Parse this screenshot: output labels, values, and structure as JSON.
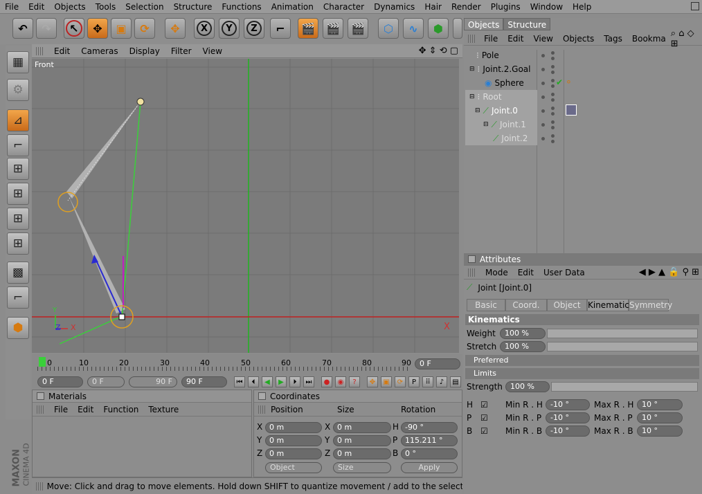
{
  "menu": [
    "File",
    "Edit",
    "Objects",
    "Tools",
    "Selection",
    "Structure",
    "Functions",
    "Animation",
    "Character",
    "Dynamics",
    "Hair",
    "Render",
    "Plugins",
    "Window",
    "Help"
  ],
  "viewport": {
    "menu": [
      "Edit",
      "Cameras",
      "Display",
      "Filter",
      "View"
    ],
    "label": "Front",
    "axis_x": "X",
    "axis_z": "Z",
    "axis_y": "Y",
    "corner_x": "X"
  },
  "timeline": {
    "ticks": [
      "0",
      "10",
      "20",
      "30",
      "40",
      "50",
      "60",
      "70",
      "80",
      "90"
    ],
    "current_frame": "0 F",
    "start": "0 F",
    "range_start": "0 F",
    "range_end": "90 F",
    "end": "90 F"
  },
  "materials": {
    "title": "Materials",
    "menu": [
      "File",
      "Edit",
      "Function",
      "Texture"
    ]
  },
  "coordinates": {
    "title": "Coordinates",
    "headers": [
      "Position",
      "Size",
      "Rotation"
    ],
    "rows": [
      {
        "a": "X",
        "pos": "0 m",
        "b": "X",
        "size": "0 m",
        "c": "H",
        "rot": "-90 °"
      },
      {
        "a": "Y",
        "pos": "0 m",
        "b": "Y",
        "size": "0 m",
        "c": "P",
        "rot": "115.211 °"
      },
      {
        "a": "Z",
        "pos": "0 m",
        "b": "Z",
        "size": "0 m",
        "c": "B",
        "rot": "0 °"
      }
    ],
    "mode": "Object",
    "size_mode": "Size",
    "apply": "Apply"
  },
  "status": "Move: Click and drag to move elements. Hold down SHIFT to quantize movement / add to the selection in point mode, CTRL",
  "brand": {
    "maxon": "MAXON",
    "product": "CINEMA 4D"
  },
  "objects": {
    "tabs": [
      "Objects",
      "Structure"
    ],
    "menu": [
      "File",
      "Edit",
      "View",
      "Objects",
      "Tags",
      "Bookma"
    ],
    "items": [
      {
        "name": "Pole"
      },
      {
        "name": "Joint.2.Goal"
      },
      {
        "name": "Sphere"
      },
      {
        "name": "Root"
      },
      {
        "name": "Joint.0"
      },
      {
        "name": "Joint.1"
      },
      {
        "name": "Joint.2"
      }
    ]
  },
  "attributes": {
    "title": "Attributes",
    "menu": [
      "Mode",
      "Edit",
      "User Data"
    ],
    "object": "Joint [Joint.0]",
    "tabs": [
      "Basic",
      "Coord.",
      "Object",
      "Kinematics",
      "Symmetry"
    ],
    "section": "Kinematics",
    "weight_label": "Weight",
    "weight": "100 %",
    "stretch_label": "Stretch",
    "stretch": "100 %",
    "preferred": "Preferred",
    "limits": "Limits",
    "strength_label": "Strength",
    "strength": "100 %",
    "limit_rows": [
      {
        "axis": "H",
        "min_label": "Min R . H",
        "min": "-10 °",
        "max_label": "Max R . H",
        "max": "10 °"
      },
      {
        "axis": "P",
        "min_label": "Min R . P",
        "min": "-10 °",
        "max_label": "Max R . P",
        "max": "10 °"
      },
      {
        "axis": "B",
        "min_label": "Min R . B",
        "min": "-10 °",
        "max_label": "Max R . B",
        "max": "10 °"
      }
    ]
  }
}
